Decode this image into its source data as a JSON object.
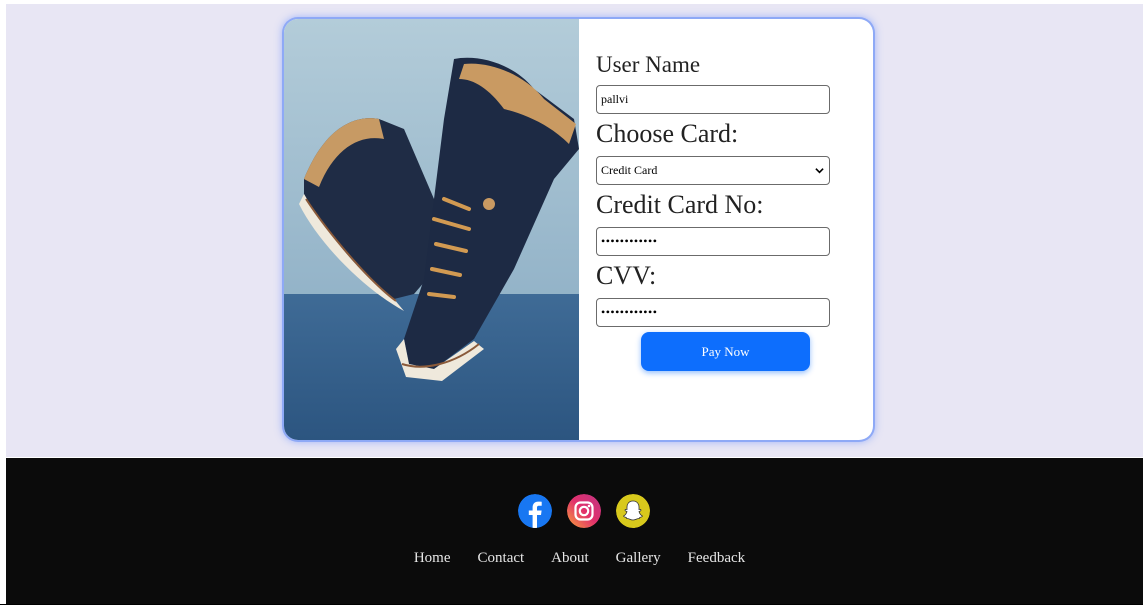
{
  "form": {
    "username_label": "User Name",
    "username_value": "pallvi",
    "card_label": "Choose Card:",
    "card_selected": "Credit Card",
    "card_no_label": "Credit Card No:",
    "card_no_masked": "••••••••••••",
    "cvv_label": "CVV:",
    "cvv_masked": "••••••••••••",
    "pay_label": "Pay Now"
  },
  "footer": {
    "social": [
      "facebook-icon",
      "instagram-icon",
      "snapchat-icon"
    ],
    "nav": [
      "Home",
      "Contact",
      "About",
      "Gallery",
      "Feedback"
    ]
  },
  "colors": {
    "page_bg": "#e8e6f4",
    "accent": "#0d6efd",
    "footer_bg": "#0b0b0b",
    "card_glow": "#8ea9f6"
  }
}
